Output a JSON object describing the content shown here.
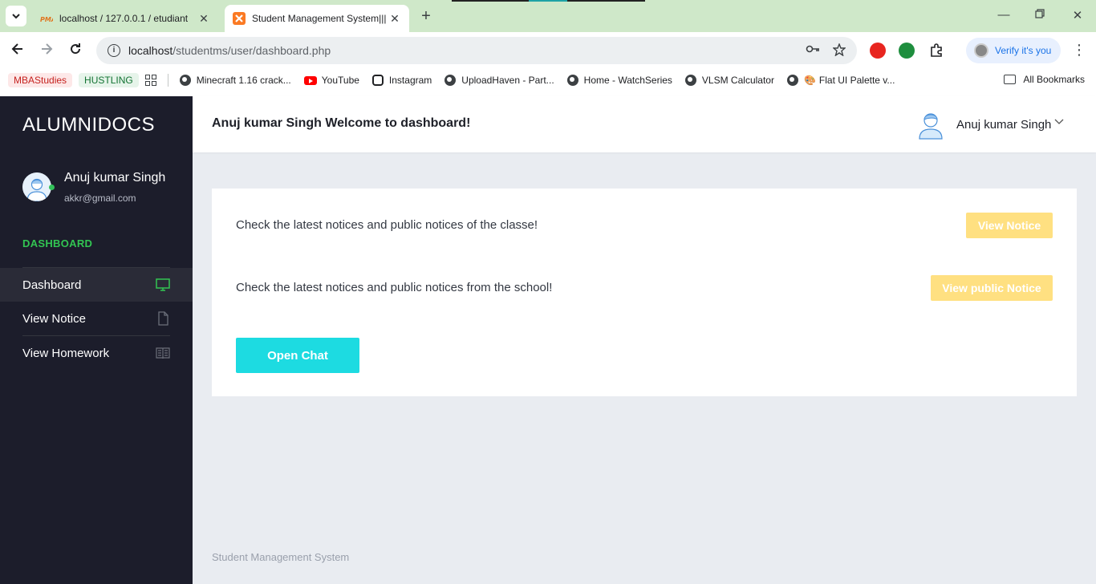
{
  "browser": {
    "tabs": [
      {
        "title": "localhost / 127.0.0.1 / etudiant",
        "favicon": "phpmyadmin-icon",
        "active": false
      },
      {
        "title": "Student Management System|||",
        "favicon": "xampp-icon",
        "active": true
      }
    ],
    "url_host": "localhost",
    "url_path": "/studentms/user/dashboard.php",
    "verify_label": "Verify it's you",
    "bookmarks": {
      "pill1": "MBAStudies",
      "pill2": "HUSTLING",
      "items": [
        "Minecraft 1.16 crack...",
        "YouTube",
        "Instagram",
        "UploadHaven - Part...",
        "Home - WatchSeries",
        "VLSM Calculator",
        "Flat UI Palette v..."
      ],
      "all_bookmarks": "All Bookmarks"
    }
  },
  "sidebar": {
    "brand": "ALUMNIDOCS",
    "user_name": "Anuj kumar Singh",
    "user_email": "akkr@gmail.com",
    "section": "DASHBOARD",
    "items": [
      {
        "label": "Dashboard",
        "icon": "monitor-icon",
        "active": true
      },
      {
        "label": "View Notice",
        "icon": "file-icon",
        "active": false
      },
      {
        "label": "View Homework",
        "icon": "book-icon",
        "active": false
      }
    ]
  },
  "header": {
    "title": "Anuj kumar Singh Welcome to dashboard!",
    "user_name": "Anuj kumar Singh"
  },
  "main": {
    "notice_text": "Check the latest notices and public notices of the classe!",
    "notice_button": "View Notice",
    "public_text": "Check the latest notices and public notices from the school!",
    "public_button": "View public Notice",
    "chat_button": "Open Chat"
  },
  "footer": {
    "text": "Student Management System"
  },
  "colors": {
    "sidebar_bg": "#1c1d2b",
    "accent_green": "#32c552",
    "button_yellow": "#ffe081",
    "chat_cyan": "#1ddbe1",
    "content_bg": "#e9ecf1"
  }
}
